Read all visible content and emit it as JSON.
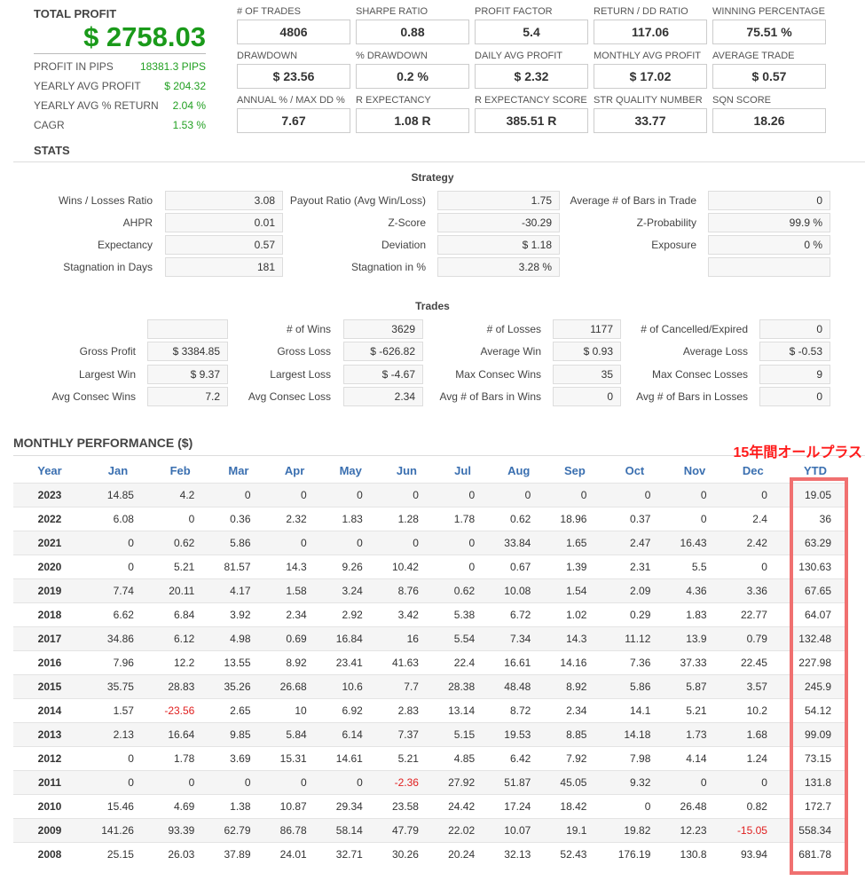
{
  "summary": {
    "total_profit_label": "TOTAL PROFIT",
    "total_profit": "$ 2758.03",
    "rows": [
      {
        "label": "PROFIT IN PIPS",
        "value": "18381.3 PIPS"
      },
      {
        "label": "YEARLY AVG PROFIT",
        "value": "$ 204.32"
      },
      {
        "label": "YEARLY AVG % RETURN",
        "value": "2.04 %"
      },
      {
        "label": "CAGR",
        "value": "1.53 %"
      }
    ]
  },
  "metrics": [
    [
      {
        "label": "# OF TRADES",
        "value": "4806"
      },
      {
        "label": "SHARPE RATIO",
        "value": "0.88"
      },
      {
        "label": "PROFIT FACTOR",
        "value": "5.4"
      },
      {
        "label": "RETURN / DD RATIO",
        "value": "117.06"
      },
      {
        "label": "WINNING PERCENTAGE",
        "value": "75.51 %"
      }
    ],
    [
      {
        "label": "DRAWDOWN",
        "value": "$ 23.56"
      },
      {
        "label": "% DRAWDOWN",
        "value": "0.2 %"
      },
      {
        "label": "DAILY AVG PROFIT",
        "value": "$ 2.32"
      },
      {
        "label": "MONTHLY AVG PROFIT",
        "value": "$ 17.02"
      },
      {
        "label": "AVERAGE TRADE",
        "value": "$ 0.57"
      }
    ],
    [
      {
        "label": "ANNUAL % / MAX DD %",
        "value": "7.67"
      },
      {
        "label": "R EXPECTANCY",
        "value": "1.08 R"
      },
      {
        "label": "R EXPECTANCY SCORE",
        "value": "385.51 R"
      },
      {
        "label": "STR QUALITY NUMBER",
        "value": "33.77"
      },
      {
        "label": "SQN SCORE",
        "value": "18.26"
      }
    ]
  ],
  "stats": {
    "title": "STATS",
    "strategy_title": "Strategy",
    "strategy": [
      [
        {
          "label": "Wins / Losses Ratio",
          "value": "3.08"
        },
        {
          "label": "Payout Ratio (Avg Win/Loss)",
          "value": "1.75"
        },
        {
          "label": "Average # of Bars in Trade",
          "value": "0"
        }
      ],
      [
        {
          "label": "AHPR",
          "value": "0.01"
        },
        {
          "label": "Z-Score",
          "value": "-30.29"
        },
        {
          "label": "Z-Probability",
          "value": "99.9 %"
        }
      ],
      [
        {
          "label": "Expectancy",
          "value": "0.57"
        },
        {
          "label": "Deviation",
          "value": "$ 1.18"
        },
        {
          "label": "Exposure",
          "value": "0 %"
        }
      ],
      [
        {
          "label": "Stagnation in Days",
          "value": "181"
        },
        {
          "label": "Stagnation in %",
          "value": "3.28 %"
        },
        {
          "label": "",
          "value": ""
        }
      ]
    ],
    "trades_title": "Trades",
    "trades": [
      [
        {
          "label": "",
          "value": ""
        },
        {
          "label": "# of Wins",
          "value": "3629"
        },
        {
          "label": "# of Losses",
          "value": "1177"
        },
        {
          "label": "# of Cancelled/Expired",
          "value": "0"
        }
      ],
      [
        {
          "label": "Gross Profit",
          "value": "$ 3384.85"
        },
        {
          "label": "Gross Loss",
          "value": "$ -626.82"
        },
        {
          "label": "Average Win",
          "value": "$ 0.93"
        },
        {
          "label": "Average Loss",
          "value": "$ -0.53"
        }
      ],
      [
        {
          "label": "Largest Win",
          "value": "$ 9.37"
        },
        {
          "label": "Largest Loss",
          "value": "$ -4.67"
        },
        {
          "label": "Max Consec Wins",
          "value": "35"
        },
        {
          "label": "Max Consec Losses",
          "value": "9"
        }
      ],
      [
        {
          "label": "Avg Consec Wins",
          "value": "7.2"
        },
        {
          "label": "Avg Consec Loss",
          "value": "2.34"
        },
        {
          "label": "Avg # of Bars in Wins",
          "value": "0"
        },
        {
          "label": "Avg # of Bars in Losses",
          "value": "0"
        }
      ]
    ]
  },
  "monthly": {
    "title": "MONTHLY PERFORMANCE ($)",
    "note": "15年間オールプラス",
    "highlight_color": "#f07070",
    "headers": [
      "Year",
      "Jan",
      "Feb",
      "Mar",
      "Apr",
      "May",
      "Jun",
      "Jul",
      "Aug",
      "Sep",
      "Oct",
      "Nov",
      "Dec",
      "YTD"
    ],
    "rows": [
      [
        "2023",
        "14.85",
        "4.2",
        "0",
        "0",
        "0",
        "0",
        "0",
        "0",
        "0",
        "0",
        "0",
        "0",
        "19.05"
      ],
      [
        "2022",
        "6.08",
        "0",
        "0.36",
        "2.32",
        "1.83",
        "1.28",
        "1.78",
        "0.62",
        "18.96",
        "0.37",
        "0",
        "2.4",
        "36"
      ],
      [
        "2021",
        "0",
        "0.62",
        "5.86",
        "0",
        "0",
        "0",
        "0",
        "33.84",
        "1.65",
        "2.47",
        "16.43",
        "2.42",
        "63.29"
      ],
      [
        "2020",
        "0",
        "5.21",
        "81.57",
        "14.3",
        "9.26",
        "10.42",
        "0",
        "0.67",
        "1.39",
        "2.31",
        "5.5",
        "0",
        "130.63"
      ],
      [
        "2019",
        "7.74",
        "20.11",
        "4.17",
        "1.58",
        "3.24",
        "8.76",
        "0.62",
        "10.08",
        "1.54",
        "2.09",
        "4.36",
        "3.36",
        "67.65"
      ],
      [
        "2018",
        "6.62",
        "6.84",
        "3.92",
        "2.34",
        "2.92",
        "3.42",
        "5.38",
        "6.72",
        "1.02",
        "0.29",
        "1.83",
        "22.77",
        "64.07"
      ],
      [
        "2017",
        "34.86",
        "6.12",
        "4.98",
        "0.69",
        "16.84",
        "16",
        "5.54",
        "7.34",
        "14.3",
        "11.12",
        "13.9",
        "0.79",
        "132.48"
      ],
      [
        "2016",
        "7.96",
        "12.2",
        "13.55",
        "8.92",
        "23.41",
        "41.63",
        "22.4",
        "16.61",
        "14.16",
        "7.36",
        "37.33",
        "22.45",
        "227.98"
      ],
      [
        "2015",
        "35.75",
        "28.83",
        "35.26",
        "26.68",
        "10.6",
        "7.7",
        "28.38",
        "48.48",
        "8.92",
        "5.86",
        "5.87",
        "3.57",
        "245.9"
      ],
      [
        "2014",
        "1.57",
        "-23.56",
        "2.65",
        "10",
        "6.92",
        "2.83",
        "13.14",
        "8.72",
        "2.34",
        "14.1",
        "5.21",
        "10.2",
        "54.12"
      ],
      [
        "2013",
        "2.13",
        "16.64",
        "9.85",
        "5.84",
        "6.14",
        "7.37",
        "5.15",
        "19.53",
        "8.85",
        "14.18",
        "1.73",
        "1.68",
        "99.09"
      ],
      [
        "2012",
        "0",
        "1.78",
        "3.69",
        "15.31",
        "14.61",
        "5.21",
        "4.85",
        "6.42",
        "7.92",
        "7.98",
        "4.14",
        "1.24",
        "73.15"
      ],
      [
        "2011",
        "0",
        "0",
        "0",
        "0",
        "0",
        "-2.36",
        "27.92",
        "51.87",
        "45.05",
        "9.32",
        "0",
        "0",
        "131.8"
      ],
      [
        "2010",
        "15.46",
        "4.69",
        "1.38",
        "10.87",
        "29.34",
        "23.58",
        "24.42",
        "17.24",
        "18.42",
        "0",
        "26.48",
        "0.82",
        "172.7"
      ],
      [
        "2009",
        "141.26",
        "93.39",
        "62.79",
        "86.78",
        "58.14",
        "47.79",
        "22.02",
        "10.07",
        "19.1",
        "19.82",
        "12.23",
        "-15.05",
        "558.34"
      ],
      [
        "2008",
        "25.15",
        "26.03",
        "37.89",
        "24.01",
        "32.71",
        "30.26",
        "20.24",
        "32.13",
        "52.43",
        "176.19",
        "130.8",
        "93.94",
        "681.78"
      ]
    ]
  }
}
